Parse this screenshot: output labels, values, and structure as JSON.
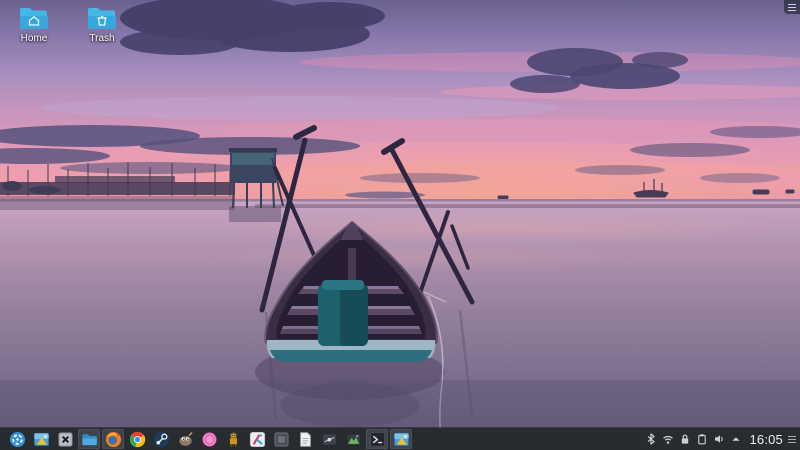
{
  "desktop": {
    "icons": [
      {
        "label": "Home",
        "icon": "home-folder-icon"
      },
      {
        "label": "Trash",
        "icon": "trash-folder-icon"
      }
    ],
    "toolbox": {
      "icon": "desktop-toolbox-menu-icon"
    }
  },
  "wallpaper": {
    "description": "Wooden boat with crossed bamboo poles on calm water at a purple-pink sunset; fishing net structures and a stilt hut on the left, small fishing boats on the right horizon",
    "colors": {
      "sky_top": "#6a6190",
      "sky_lilac": "#a990c0",
      "sky_pink": "#e09ab8",
      "horizon_glow": "#f2a49e",
      "water_top": "#c9a5c2",
      "water_bottom": "#635a76",
      "silhouette": "#413a56",
      "boat_teal": "#2e6e80"
    }
  },
  "taskbar": {
    "background": "#282c31",
    "items": [
      {
        "name": "app-launcher",
        "icon": "plasma-logo-icon",
        "open": false
      },
      {
        "name": "gallery-app",
        "icon": "image-gallery-icon",
        "open": false
      },
      {
        "name": "x11-app",
        "icon": "letter-x-icon",
        "open": false
      },
      {
        "name": "dolphin-file-manager",
        "icon": "blue-folder-icon",
        "open": true
      },
      {
        "name": "firefox",
        "icon": "firefox-icon",
        "open": true
      },
      {
        "name": "chrome",
        "icon": "chrome-icon",
        "open": false
      },
      {
        "name": "steam",
        "icon": "steam-icon",
        "open": false
      },
      {
        "name": "gimp",
        "icon": "gimp-icon",
        "open": false
      },
      {
        "name": "pink-circle-app",
        "icon": "pink-circle-icon",
        "open": false
      },
      {
        "name": "robot-app",
        "icon": "robot-icon",
        "open": false
      },
      {
        "name": "krita",
        "icon": "krita-icon",
        "open": false
      },
      {
        "name": "pending-app",
        "icon": "ghost-square-icon",
        "open": false
      },
      {
        "name": "document-app",
        "icon": "document-icon",
        "open": false
      },
      {
        "name": "mixer-app",
        "icon": "slider-icon",
        "open": false
      },
      {
        "name": "image-viewer-app",
        "icon": "green-landscape-icon",
        "open": false
      },
      {
        "name": "konsole-terminal",
        "icon": "terminal-prompt-icon",
        "open": true
      },
      {
        "name": "image-viewer-task",
        "icon": "image-gallery-icon",
        "open": true
      }
    ],
    "tray": [
      {
        "name": "bluetooth",
        "icon": "bluetooth-icon"
      },
      {
        "name": "network",
        "icon": "wifi-icon"
      },
      {
        "name": "screen-lock",
        "icon": "padlock-icon"
      },
      {
        "name": "clipboard",
        "icon": "clipboard-icon"
      },
      {
        "name": "volume",
        "icon": "speaker-icon"
      },
      {
        "name": "tray-expander",
        "icon": "caret-up-icon"
      }
    ],
    "clock": "16:05",
    "panel_toggle": {
      "icon": "panel-menu-icon"
    }
  }
}
